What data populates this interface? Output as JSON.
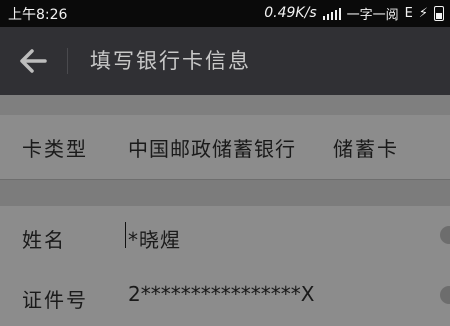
{
  "status_bar": {
    "time": "上午8:26",
    "net_speed": "0.49K/s",
    "carrier": "一字一阅",
    "network_type": "E",
    "charging_symbol": "⚡"
  },
  "app_bar": {
    "title": "填写银行卡信息",
    "back_icon": "arrow-left-icon"
  },
  "card_row": {
    "label": "卡类型",
    "bank_name": "中国邮政储蓄银行",
    "card_type": "储蓄卡"
  },
  "name_row": {
    "label": "姓名",
    "value": "*晓煋"
  },
  "id_row": {
    "label": "证件号",
    "value": "2****************X"
  },
  "colors": {
    "status_bar": "#0a0a0a",
    "app_bar": "#303034",
    "overlay_background": "#8c8c8c"
  }
}
